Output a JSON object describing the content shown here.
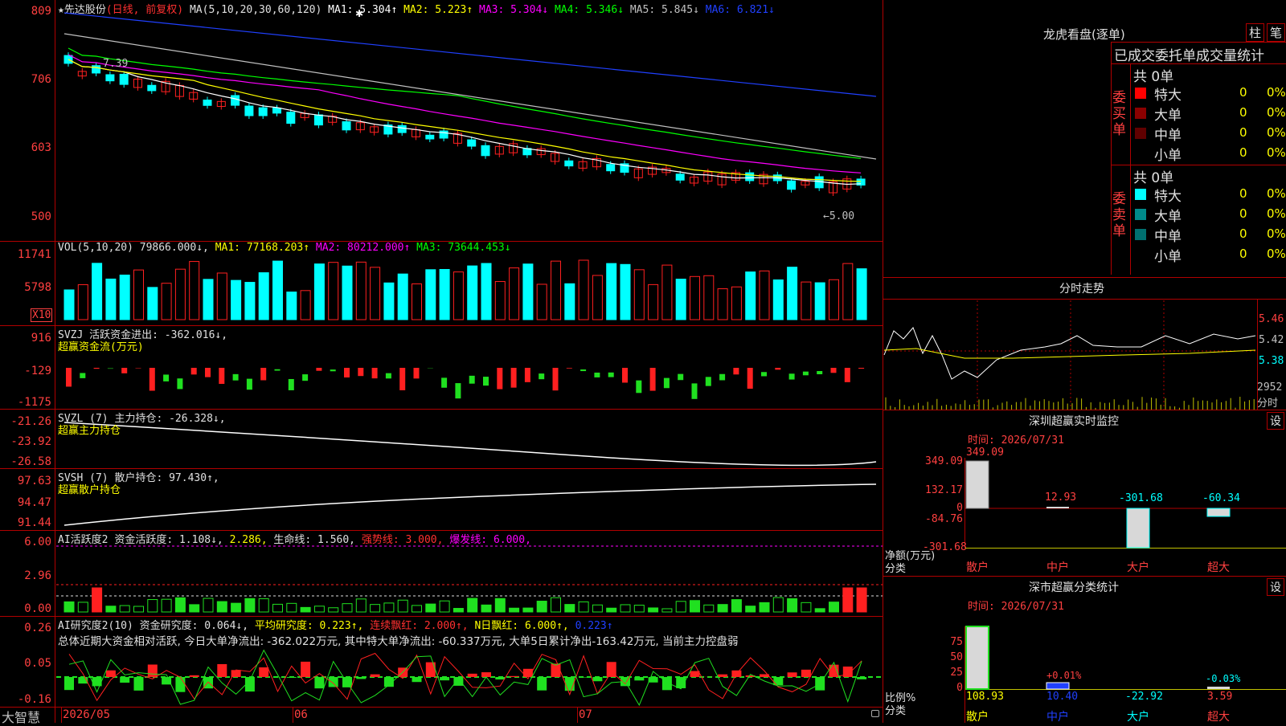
{
  "colors": {
    "up": "#ff2020",
    "down": "#00ffff",
    "bull_green": "#20e020",
    "bg": "#000000",
    "grid": "#b00000"
  },
  "kline": {
    "title": "★先达股份",
    "subtitle": "(日线, 前复权)",
    "ma_label": "MA(5,10,20,30,60,120)",
    "ma1": "MA1: 5.304↑",
    "ma2": "MA2: 5.223↑",
    "ma3": "MA3: 5.304↓",
    "ma4": "MA4: 5.346↓",
    "ma5": "MA5: 5.845↓",
    "ma6": "MA6: 6.821↓",
    "y_ticks": [
      "809",
      "706",
      "603",
      "500"
    ],
    "high_note": "7.39",
    "low_note": "←5.00"
  },
  "vol": {
    "title": "VOL(5,10,20)",
    "value": "79866.000↓",
    "ma1": "MA1: 77168.203↑",
    "ma2": "MA2: 80212.000↑",
    "ma3": "MA3: 73644.453↓",
    "y_ticks": [
      "11741",
      "5798"
    ],
    "unit": "X10"
  },
  "svzj": {
    "title": "SVZJ",
    "label": "活跃资金进出: -362.016↓,",
    "sub": "超赢资金流(万元)",
    "y_ticks": [
      "916",
      "-129",
      "-1175"
    ]
  },
  "svzl": {
    "title": "SVZL (7)",
    "label": "主力持仓: -26.328↓,",
    "sub": "超赢主力持仓",
    "y_ticks": [
      "-21.26",
      "-23.92",
      "-26.58"
    ]
  },
  "svsh": {
    "title": "SVSH (7)",
    "label": "散户持仓: 97.430↑,",
    "sub": "超赢散户持仓",
    "y_ticks": [
      "97.63",
      "94.47",
      "91.44"
    ]
  },
  "ai1": {
    "title": "AI活跃度2",
    "l1": "资金活跃度: 1.108↓,",
    "l2": "2.286,",
    "l3": "生命线: 1.560,",
    "l4": "强势线: 3.000,",
    "l5": "爆发线: 6.000,",
    "y_ticks": [
      "6.00",
      "2.96",
      "0.00"
    ]
  },
  "ai2": {
    "title": "AI研究度2(10)",
    "l1": "资金研究度: 0.064↓,",
    "l2": "平均研究度: 0.223↑,",
    "l3": "连续飘红: 2.000↑,",
    "l4": "N日飘红: 6.000↑,",
    "l5": "0.223↑",
    "summary": "总体近期大资金相对活跃, 今日大单净流出: -362.022万元, 其中特大单净流出: -60.337万元, 大单5日累计净出-163.42万元, 当前主力控盘弱",
    "y_ticks": [
      "0.26",
      "0.05",
      "-0.16"
    ]
  },
  "xaxis": {
    "brand": "大智慧",
    "labels": [
      "2026/05",
      "06",
      "07"
    ]
  },
  "right": {
    "lhb_title": "龙虎看盘(逐单)",
    "btn_col": "柱",
    "btn_pen": "笔",
    "order_header": "已成交委托单成交量统计",
    "buy_side": {
      "label": "委买单",
      "total": "共 0单",
      "rows": [
        {
          "name": "特大",
          "count": "0",
          "pct": "0%",
          "color": "#ff0000"
        },
        {
          "name": "大单",
          "count": "0",
          "pct": "0%",
          "color": "#8b0000"
        },
        {
          "name": "中单",
          "count": "0",
          "pct": "0%",
          "color": "#600000"
        },
        {
          "name": "小单",
          "count": "0",
          "pct": "0%",
          "color": ""
        }
      ]
    },
    "sell_side": {
      "label": "委卖单",
      "total": "共 0单",
      "rows": [
        {
          "name": "特大",
          "count": "0",
          "pct": "0%",
          "color": "#00ffff"
        },
        {
          "name": "大单",
          "count": "0",
          "pct": "0%",
          "color": "#008b8b"
        },
        {
          "name": "中单",
          "count": "0",
          "pct": "0%",
          "color": "#007070"
        },
        {
          "name": "小单",
          "count": "0",
          "pct": "0%",
          "color": ""
        }
      ]
    },
    "intraday": {
      "title": "分时走势",
      "y_ticks": [
        "5.46",
        "5.42",
        "5.38"
      ],
      "vol": "2952",
      "vol_label": "分时"
    },
    "monitor": {
      "title": "深圳超赢实时监控",
      "settings": "设",
      "time": "时间: 2026/07/31",
      "y_ticks": [
        "349.09",
        "132.17",
        "0",
        "-84.76",
        "-301.68"
      ],
      "unit": "净额(万元)",
      "cat_label": "分类",
      "bars": [
        {
          "cat": "散户",
          "value": "349.09"
        },
        {
          "cat": "中户",
          "value": "12.93"
        },
        {
          "cat": "大户",
          "value": "-301.68"
        },
        {
          "cat": "超大",
          "value": "-60.34"
        }
      ]
    },
    "classify": {
      "title": "深市超赢分类统计",
      "settings": "设",
      "time": "时间: 2026/07/31",
      "y_ticks": [
        "75",
        "50",
        "25",
        "0"
      ],
      "ratio_label": "比例%",
      "cat_label": "分类",
      "bars": [
        {
          "cat": "散户",
          "value": "108.93",
          "note": ""
        },
        {
          "cat": "中户",
          "value": "10.40",
          "note": "+0.01%"
        },
        {
          "cat": "大户",
          "value": "-22.92",
          "note": ""
        },
        {
          "cat": "超大",
          "value": "3.59",
          "note": "-0.03%"
        }
      ]
    }
  }
}
